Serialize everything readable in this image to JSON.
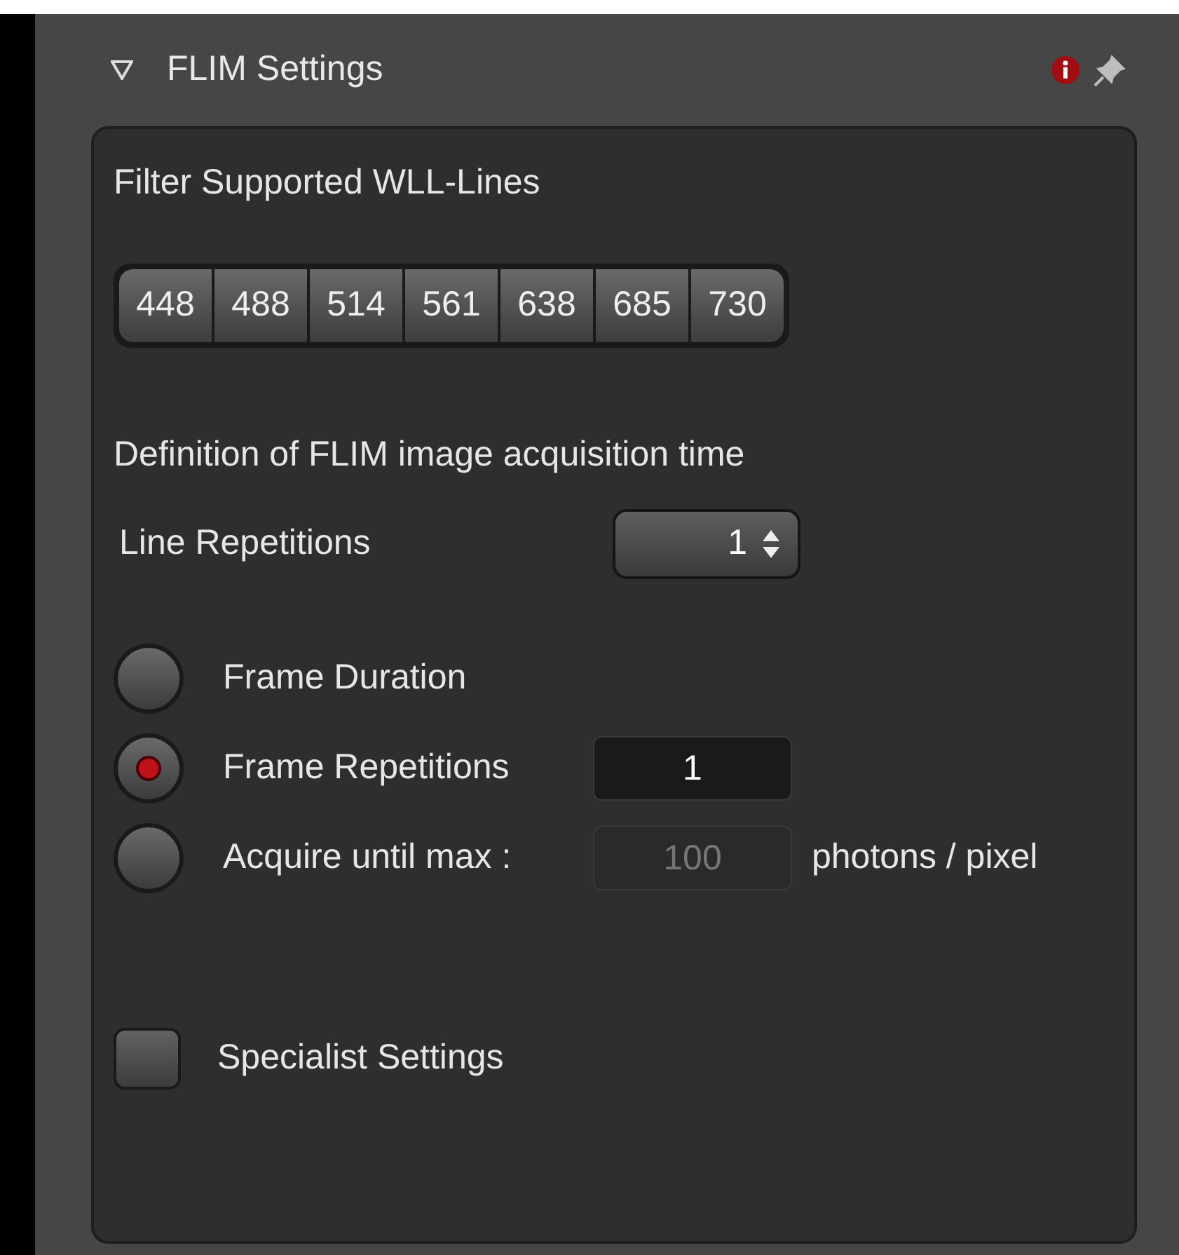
{
  "panel": {
    "title": "FLIM Settings",
    "expanded": true
  },
  "filter": {
    "label": "Filter Supported WLL-Lines",
    "lines": [
      "448",
      "488",
      "514",
      "561",
      "638",
      "685",
      "730"
    ]
  },
  "acquisition": {
    "heading": "Definition of FLIM image acquisition time",
    "line_repetitions": {
      "label": "Line Repetitions",
      "value": "1"
    },
    "modes": [
      {
        "label": "Frame Duration",
        "selected": false
      },
      {
        "label": "Frame Repetitions",
        "selected": true,
        "value": "1",
        "disabled": false
      },
      {
        "label": "Acquire until max :",
        "selected": false,
        "value": "100",
        "disabled": true,
        "unit": "photons / pixel"
      }
    ]
  },
  "specialist": {
    "label": "Specialist Settings",
    "checked": false
  }
}
